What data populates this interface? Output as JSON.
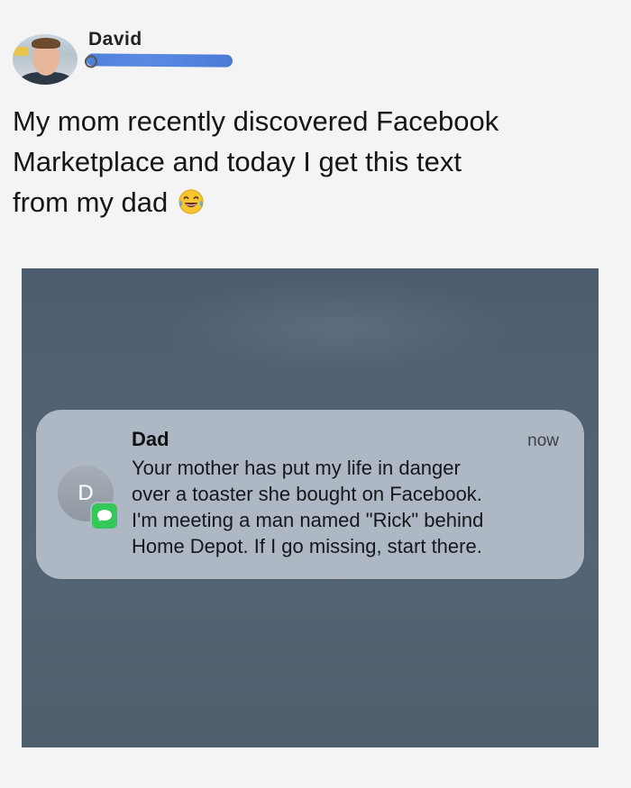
{
  "tweet": {
    "author_name": "David",
    "text_lines": [
      "My mom recently discovered Facebook",
      "Marketplace and today I get this text",
      "from my dad"
    ],
    "emoji": "face-with-tears-of-joy-icon"
  },
  "notification": {
    "avatar_initial": "D",
    "sender": "Dad",
    "time": "now",
    "app_badge": "messages-icon",
    "body_lines": [
      "Your mother has put my life in danger",
      "over a toaster she bought on Facebook.",
      "I'm meeting a man named \"Rick\" behind",
      "Home Depot. If I go missing, start there."
    ]
  },
  "colors": {
    "notification_bg": "#aeb8c4",
    "screenshot_bg": "#536272",
    "messages_green": "#34c759",
    "redaction_blue": "#5b8ae3"
  }
}
